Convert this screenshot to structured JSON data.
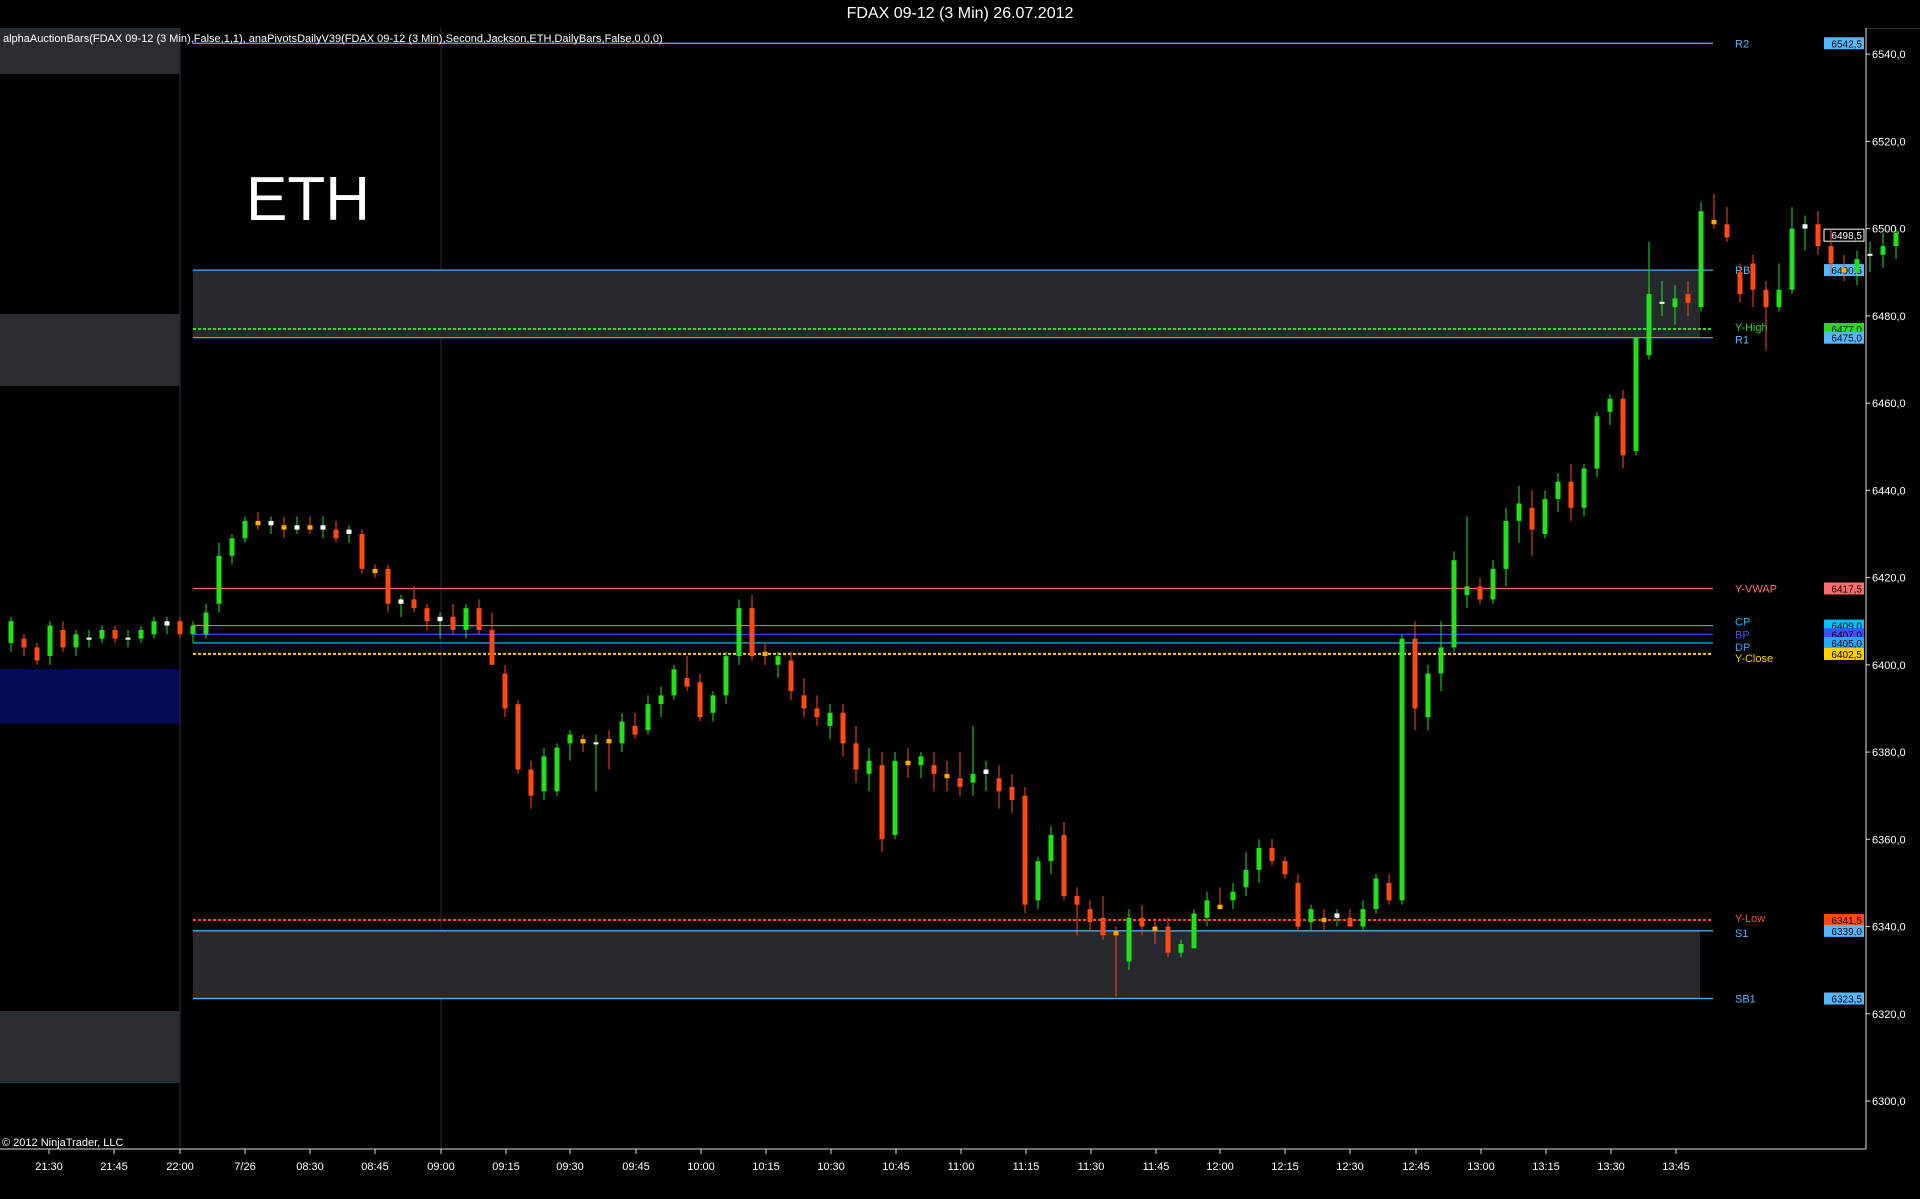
{
  "window": {
    "title": "FDAX 09-12 (3 Min)  26.07.2012"
  },
  "indicators_text": "alphaAuctionBars(FDAX 09-12 (3 Min),False,1,1), anaPivotsDailyV39(FDAX 09-12 (3 Min),Second,Jackson,ETH,DailyBars,False,0,0,0)",
  "watermark": "ETH",
  "copyright": "© 2012 NinjaTrader, LLC",
  "colors": {
    "up": "#22e01a",
    "down": "#ff4a14",
    "doji_up": "#ffffff",
    "doji_down": "#ffaa00",
    "pivot": "#55b8ff",
    "yhigh": "#22e01a",
    "ylow": "#ff4a14",
    "yvwap": "#ff6a6a",
    "yclose": "#ffd000",
    "cp": "#00c0ff",
    "bp": "#3355ff",
    "dp": "#22aaff"
  },
  "chart_data": {
    "type": "candlestick",
    "title": "FDAX 09-12 (3 Min)  26.07.2012",
    "ylim": [
      6289,
      6546
    ],
    "y_ticks": [
      "6540,0",
      "6520,0",
      "6500,0",
      "6480,0",
      "6460,0",
      "6440,0",
      "6420,0",
      "6400,0",
      "6380,0",
      "6360,0",
      "6340,0",
      "6320,0",
      "6300,0"
    ],
    "y_tick_values": [
      6540,
      6520,
      6500,
      6480,
      6460,
      6440,
      6420,
      6400,
      6380,
      6360,
      6340,
      6320,
      6300
    ],
    "x_ticks": [
      "21:30",
      "21:45",
      "22:00",
      "7/26",
      "08:30",
      "08:45",
      "09:00",
      "09:15",
      "09:30",
      "09:45",
      "10:00",
      "10:15",
      "10:30",
      "10:45",
      "11:00",
      "11:15",
      "11:30",
      "11:45",
      "12:00",
      "12:15",
      "12:30",
      "12:45",
      "13:00",
      "13:15",
      "13:30",
      "13:45"
    ],
    "levels": [
      {
        "name": "R2",
        "value": 6542.5,
        "label": "6542,5",
        "color": "#55b8ff"
      },
      {
        "name": "RB1",
        "value": 6490.5,
        "label": "6490,5",
        "color": "#55b8ff"
      },
      {
        "name": "Y-High",
        "value": 6477.0,
        "label": "6477,0",
        "color": "#22e01a"
      },
      {
        "name": "R1",
        "value": 6475.0,
        "label": "6475,0",
        "color": "#55b8ff"
      },
      {
        "name": "Y-VWAP",
        "value": 6417.5,
        "label": "6417,5",
        "color": "#ff6a6a"
      },
      {
        "name": "CP",
        "value": 6409.0,
        "label": "6409,0",
        "color": "#00c0ff"
      },
      {
        "name": "BP",
        "value": 6407.0,
        "label": "6407,0",
        "color": "#3355ff"
      },
      {
        "name": "DP",
        "value": 6405.0,
        "label": "6405,0",
        "color": "#22aaff"
      },
      {
        "name": "Y-Close",
        "value": 6402.5,
        "label": "6402,5",
        "color": "#ffd000"
      },
      {
        "name": "Y-Low",
        "value": 6341.5,
        "label": "6341,5",
        "color": "#ff4a14"
      },
      {
        "name": "S1",
        "value": 6339.0,
        "label": "6339,0",
        "color": "#55b8ff"
      },
      {
        "name": "SB1",
        "value": 6323.5,
        "label": "6323,5",
        "color": "#55b8ff"
      }
    ],
    "last_price": {
      "value": 6498.5,
      "label": "6498,5"
    },
    "bands": [
      {
        "from": 6475.0,
        "to": 6490.5
      },
      {
        "from": 6323.5,
        "to": 6339.0
      }
    ],
    "candles": [
      {
        "o": 6405,
        "h": 6411,
        "l": 6403,
        "c": 6410
      },
      {
        "o": 6406,
        "h": 6407,
        "l": 6402,
        "c": 6404
      },
      {
        "o": 6404,
        "h": 6405,
        "l": 6400,
        "c": 6401
      },
      {
        "o": 6402,
        "h": 6410,
        "l": 6400,
        "c": 6409
      },
      {
        "o": 6408,
        "h": 6410,
        "l": 6403,
        "c": 6404
      },
      {
        "o": 6404,
        "h": 6408,
        "l": 6402,
        "c": 6407
      },
      {
        "o": 6406,
        "h": 6408,
        "l": 6404,
        "c": 6406
      },
      {
        "o": 6406,
        "h": 6409,
        "l": 6405,
        "c": 6408
      },
      {
        "o": 6408,
        "h": 6409,
        "l": 6405,
        "c": 6406
      },
      {
        "o": 6406,
        "h": 6408,
        "l": 6404,
        "c": 6406
      },
      {
        "o": 6406,
        "h": 6409,
        "l": 6405,
        "c": 6408
      },
      {
        "o": 6407,
        "h": 6411,
        "l": 6406,
        "c": 6410
      },
      {
        "o": 6409,
        "h": 6411,
        "l": 6407,
        "c": 6410
      },
      {
        "o": 6410,
        "h": 6411,
        "l": 6406,
        "c": 6407
      },
      {
        "o": 6407,
        "h": 6410,
        "l": 6405,
        "c": 6409
      },
      {
        "o": 6407,
        "h": 6414,
        "l": 6406,
        "c": 6412
      },
      {
        "o": 6414,
        "h": 6428,
        "l": 6412,
        "c": 6425
      },
      {
        "o": 6425,
        "h": 6430,
        "l": 6423,
        "c": 6429
      },
      {
        "o": 6429,
        "h": 6434,
        "l": 6428,
        "c": 6433
      },
      {
        "o": 6433,
        "h": 6435,
        "l": 6431,
        "c": 6432
      },
      {
        "o": 6432,
        "h": 6434,
        "l": 6430,
        "c": 6433
      },
      {
        "o": 6432,
        "h": 6434,
        "l": 6429,
        "c": 6431
      },
      {
        "o": 6431,
        "h": 6434,
        "l": 6430,
        "c": 6432
      },
      {
        "o": 6432,
        "h": 6434,
        "l": 6430,
        "c": 6431
      },
      {
        "o": 6431,
        "h": 6434,
        "l": 6429,
        "c": 6432
      },
      {
        "o": 6431,
        "h": 6433,
        "l": 6428,
        "c": 6429
      },
      {
        "o": 6430,
        "h": 6432,
        "l": 6428,
        "c": 6431
      },
      {
        "o": 6430,
        "h": 6431,
        "l": 6421,
        "c": 6422
      },
      {
        "o": 6422,
        "h": 6423,
        "l": 6420,
        "c": 6421
      },
      {
        "o": 6422,
        "h": 6423,
        "l": 6412,
        "c": 6414
      },
      {
        "o": 6414,
        "h": 6416,
        "l": 6411,
        "c": 6415
      },
      {
        "o": 6415,
        "h": 6418,
        "l": 6412,
        "c": 6413
      },
      {
        "o": 6413,
        "h": 6414,
        "l": 6408,
        "c": 6410
      },
      {
        "o": 6410,
        "h": 6412,
        "l": 6406,
        "c": 6411
      },
      {
        "o": 6411,
        "h": 6414,
        "l": 6407,
        "c": 6408
      },
      {
        "o": 6408,
        "h": 6414,
        "l": 6406,
        "c": 6413
      },
      {
        "o": 6413,
        "h": 6415,
        "l": 6407,
        "c": 6408
      },
      {
        "o": 6408,
        "h": 6412,
        "l": 6400,
        "c": 6400
      },
      {
        "o": 6398,
        "h": 6400,
        "l": 6388,
        "c": 6390
      },
      {
        "o": 6391,
        "h": 6392,
        "l": 6375,
        "c": 6376
      },
      {
        "o": 6376,
        "h": 6378,
        "l": 6367,
        "c": 6370
      },
      {
        "o": 6371,
        "h": 6381,
        "l": 6369,
        "c": 6379
      },
      {
        "o": 6371,
        "h": 6382,
        "l": 6370,
        "c": 6381
      },
      {
        "o": 6382,
        "h": 6385,
        "l": 6378,
        "c": 6384
      },
      {
        "o": 6383,
        "h": 6384,
        "l": 6380,
        "c": 6382
      },
      {
        "o": 6382,
        "h": 6384,
        "l": 6371,
        "c": 6382
      },
      {
        "o": 6383,
        "h": 6385,
        "l": 6376,
        "c": 6382
      },
      {
        "o": 6382,
        "h": 6389,
        "l": 6380,
        "c": 6387
      },
      {
        "o": 6386,
        "h": 6389,
        "l": 6383,
        "c": 6384
      },
      {
        "o": 6385,
        "h": 6393,
        "l": 6384,
        "c": 6391
      },
      {
        "o": 6391,
        "h": 6395,
        "l": 6388,
        "c": 6393
      },
      {
        "o": 6393,
        "h": 6400,
        "l": 6392,
        "c": 6399
      },
      {
        "o": 6397,
        "h": 6402,
        "l": 6394,
        "c": 6395
      },
      {
        "o": 6396,
        "h": 6398,
        "l": 6387,
        "c": 6388
      },
      {
        "o": 6389,
        "h": 6394,
        "l": 6387,
        "c": 6393
      },
      {
        "o": 6393,
        "h": 6403,
        "l": 6391,
        "c": 6402
      },
      {
        "o": 6402,
        "h": 6415,
        "l": 6400,
        "c": 6413
      },
      {
        "o": 6413,
        "h": 6416,
        "l": 6401,
        "c": 6402
      },
      {
        "o": 6403,
        "h": 6405,
        "l": 6400,
        "c": 6402
      },
      {
        "o": 6400,
        "h": 6403,
        "l": 6397,
        "c": 6402
      },
      {
        "o": 6401,
        "h": 6403,
        "l": 6392,
        "c": 6394
      },
      {
        "o": 6393,
        "h": 6397,
        "l": 6388,
        "c": 6390
      },
      {
        "o": 6390,
        "h": 6393,
        "l": 6386,
        "c": 6388
      },
      {
        "o": 6386,
        "h": 6391,
        "l": 6383,
        "c": 6389
      },
      {
        "o": 6389,
        "h": 6391,
        "l": 6379,
        "c": 6382
      },
      {
        "o": 6382,
        "h": 6386,
        "l": 6373,
        "c": 6376
      },
      {
        "o": 6375,
        "h": 6381,
        "l": 6371,
        "c": 6378
      },
      {
        "o": 6377,
        "h": 6380,
        "l": 6357,
        "c": 6360
      },
      {
        "o": 6361,
        "h": 6380,
        "l": 6360,
        "c": 6378
      },
      {
        "o": 6378,
        "h": 6381,
        "l": 6374,
        "c": 6377
      },
      {
        "o": 6377,
        "h": 6380,
        "l": 6374,
        "c": 6379
      },
      {
        "o": 6377,
        "h": 6380,
        "l": 6371,
        "c": 6375
      },
      {
        "o": 6375,
        "h": 6378,
        "l": 6371,
        "c": 6374
      },
      {
        "o": 6374,
        "h": 6380,
        "l": 6370,
        "c": 6372
      },
      {
        "o": 6373,
        "h": 6386,
        "l": 6370,
        "c": 6375
      },
      {
        "o": 6375,
        "h": 6378,
        "l": 6371,
        "c": 6376
      },
      {
        "o": 6374,
        "h": 6377,
        "l": 6367,
        "c": 6371
      },
      {
        "o": 6372,
        "h": 6375,
        "l": 6366,
        "c": 6369
      },
      {
        "o": 6370,
        "h": 6372,
        "l": 6343,
        "c": 6345
      },
      {
        "o": 6346,
        "h": 6356,
        "l": 6344,
        "c": 6355
      },
      {
        "o": 6355,
        "h": 6363,
        "l": 6352,
        "c": 6361
      },
      {
        "o": 6361,
        "h": 6364,
        "l": 6346,
        "c": 6347
      },
      {
        "o": 6347,
        "h": 6349,
        "l": 6338,
        "c": 6345
      },
      {
        "o": 6344,
        "h": 6346,
        "l": 6339,
        "c": 6341
      },
      {
        "o": 6342,
        "h": 6347,
        "l": 6337,
        "c": 6338
      },
      {
        "o": 6339,
        "h": 6340,
        "l": 6324,
        "c": 6338
      },
      {
        "o": 6332,
        "h": 6344,
        "l": 6330,
        "c": 6342
      },
      {
        "o": 6342,
        "h": 6345,
        "l": 6338,
        "c": 6340
      },
      {
        "o": 6340,
        "h": 6342,
        "l": 6336,
        "c": 6339
      },
      {
        "o": 6340,
        "h": 6342,
        "l": 6333,
        "c": 6334
      },
      {
        "o": 6334,
        "h": 6337,
        "l": 6333,
        "c": 6336
      },
      {
        "o": 6335,
        "h": 6344,
        "l": 6335,
        "c": 6343
      },
      {
        "o": 6342,
        "h": 6348,
        "l": 6340,
        "c": 6346
      },
      {
        "o": 6345,
        "h": 6349,
        "l": 6344,
        "c": 6344
      },
      {
        "o": 6346,
        "h": 6350,
        "l": 6344,
        "c": 6348
      },
      {
        "o": 6349,
        "h": 6357,
        "l": 6347,
        "c": 6353
      },
      {
        "o": 6353,
        "h": 6360,
        "l": 6350,
        "c": 6358
      },
      {
        "o": 6358,
        "h": 6360,
        "l": 6354,
        "c": 6355
      },
      {
        "o": 6355,
        "h": 6356,
        "l": 6351,
        "c": 6352
      },
      {
        "o": 6350,
        "h": 6352,
        "l": 6339,
        "c": 6340
      },
      {
        "o": 6341,
        "h": 6345,
        "l": 6339,
        "c": 6344
      },
      {
        "o": 6342,
        "h": 6344,
        "l": 6339,
        "c": 6341
      },
      {
        "o": 6342,
        "h": 6344,
        "l": 6340,
        "c": 6343
      },
      {
        "o": 6342,
        "h": 6344,
        "l": 6340,
        "c": 6340
      },
      {
        "o": 6340,
        "h": 6346,
        "l": 6339,
        "c": 6344
      },
      {
        "o": 6344,
        "h": 6352,
        "l": 6343,
        "c": 6351
      },
      {
        "o": 6350,
        "h": 6352,
        "l": 6345,
        "c": 6346
      },
      {
        "o": 6346,
        "h": 6407,
        "l": 6345,
        "c": 6406
      },
      {
        "o": 6406,
        "h": 6410,
        "l": 6385,
        "c": 6390
      },
      {
        "o": 6388,
        "h": 6400,
        "l": 6385,
        "c": 6398
      },
      {
        "o": 6398,
        "h": 6410,
        "l": 6394,
        "c": 6404
      },
      {
        "o": 6404,
        "h": 6426,
        "l": 6403,
        "c": 6424
      },
      {
        "o": 6416,
        "h": 6434,
        "l": 6413,
        "c": 6418
      },
      {
        "o": 6418,
        "h": 6420,
        "l": 6414,
        "c": 6415
      },
      {
        "o": 6415,
        "h": 6424,
        "l": 6414,
        "c": 6422
      },
      {
        "o": 6422,
        "h": 6436,
        "l": 6418,
        "c": 6433
      },
      {
        "o": 6433,
        "h": 6441,
        "l": 6428,
        "c": 6437
      },
      {
        "o": 6436,
        "h": 6440,
        "l": 6425,
        "c": 6431
      },
      {
        "o": 6430,
        "h": 6440,
        "l": 6429,
        "c": 6438
      },
      {
        "o": 6438,
        "h": 6444,
        "l": 6435,
        "c": 6442
      },
      {
        "o": 6442,
        "h": 6446,
        "l": 6433,
        "c": 6436
      },
      {
        "o": 6436,
        "h": 6446,
        "l": 6434,
        "c": 6445
      },
      {
        "o": 6445,
        "h": 6458,
        "l": 6443,
        "c": 6457
      },
      {
        "o": 6458,
        "h": 6462,
        "l": 6455,
        "c": 6461
      },
      {
        "o": 6461,
        "h": 6463,
        "l": 6445,
        "c": 6448
      },
      {
        "o": 6449,
        "h": 6475,
        "l": 6448,
        "c": 6475
      },
      {
        "o": 6471,
        "h": 6497,
        "l": 6470,
        "c": 6485
      },
      {
        "o": 6483,
        "h": 6488,
        "l": 6480,
        "c": 6483
      },
      {
        "o": 6482,
        "h": 6487,
        "l": 6478,
        "c": 6484
      },
      {
        "o": 6485,
        "h": 6488,
        "l": 6480,
        "c": 6483
      },
      {
        "o": 6482,
        "h": 6506,
        "l": 6481,
        "c": 6504
      },
      {
        "o": 6502,
        "h": 6508,
        "l": 6500,
        "c": 6501
      },
      {
        "o": 6501,
        "h": 6505,
        "l": 6497,
        "c": 6498
      },
      {
        "o": 6490,
        "h": 6492,
        "l": 6483,
        "c": 6485
      },
      {
        "o": 6492,
        "h": 6494,
        "l": 6482,
        "c": 6486
      },
      {
        "o": 6486,
        "h": 6488,
        "l": 6472,
        "c": 6482
      },
      {
        "o": 6482,
        "h": 6492,
        "l": 6481,
        "c": 6486
      },
      {
        "o": 6486,
        "h": 6505,
        "l": 6485,
        "c": 6500
      },
      {
        "o": 6500,
        "h": 6503,
        "l": 6495,
        "c": 6501
      },
      {
        "o": 6501,
        "h": 6504,
        "l": 6494,
        "c": 6496
      },
      {
        "o": 6496,
        "h": 6500,
        "l": 6489,
        "c": 6492
      },
      {
        "o": 6491,
        "h": 6494,
        "l": 6488,
        "c": 6490
      },
      {
        "o": 6490,
        "h": 6495,
        "l": 6487,
        "c": 6493
      },
      {
        "o": 6494,
        "h": 6497,
        "l": 6490,
        "c": 6494
      },
      {
        "o": 6494,
        "h": 6499,
        "l": 6491,
        "c": 6496
      },
      {
        "o": 6496,
        "h": 6500,
        "l": 6493,
        "c": 6499
      }
    ]
  }
}
